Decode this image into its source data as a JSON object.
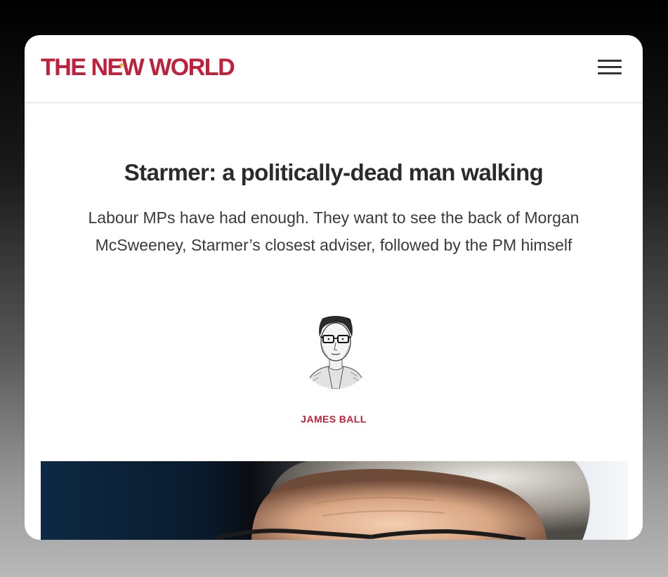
{
  "header": {
    "logo_text": "THE NEW WORLD",
    "menu_icon": "hamburger-menu-icon"
  },
  "article": {
    "headline": "Starmer: a politically-dead man walking",
    "standfirst": "Labour MPs have had enough. They want to see the back of Morgan McSweeney, Starmer’s closest adviser, followed by the PM himself",
    "author": "JAMES BALL"
  },
  "colors": {
    "brand": "#c1203b",
    "logo_star": "#e3b62e",
    "text": "#2b2b2b"
  }
}
